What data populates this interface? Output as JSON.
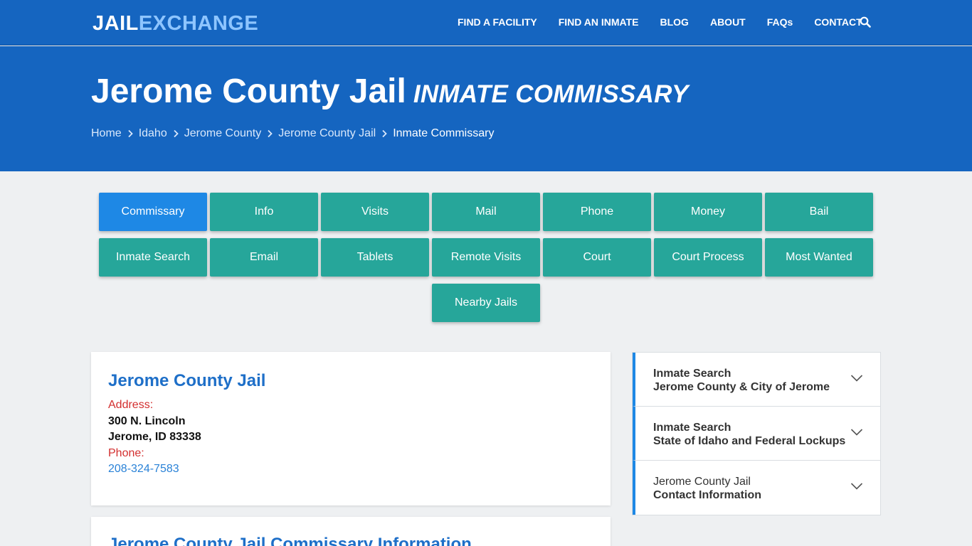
{
  "logo": {
    "part1": "JAIL",
    "part2": "EXCHANGE"
  },
  "nav": {
    "items": [
      "FIND A FACILITY",
      "FIND AN INMATE",
      "BLOG",
      "ABOUT",
      "FAQs",
      "CONTACT"
    ],
    "search_icon": "search-icon"
  },
  "hero": {
    "title": "Jerome County Jail",
    "subtitle": "INMATE COMMISSARY",
    "breadcrumbs": [
      "Home",
      "Idaho",
      "Jerome County",
      "Jerome County Jail",
      "Inmate Commissary"
    ]
  },
  "buttons": {
    "row1": [
      "Commissary",
      "Info",
      "Visits",
      "Mail",
      "Phone",
      "Money",
      "Bail"
    ],
    "row2": [
      "Inmate Search",
      "Email",
      "Tablets",
      "Remote Visits",
      "Court",
      "Court Process",
      "Most Wanted"
    ],
    "row3": [
      "Nearby Jails"
    ],
    "active": "Commissary"
  },
  "facility": {
    "title": "Jerome County Jail",
    "address_label": "Address:",
    "address_line1": "300 N. Lincoln",
    "address_line2": "Jerome, ID 83338",
    "phone_label": "Phone:",
    "phone": "208-324-7583"
  },
  "commissary_card": {
    "title": "Jerome County Jail Commissary Information"
  },
  "sidebar": {
    "items": [
      {
        "line1": "Inmate Search",
        "line2": "Jerome County & City of Jerome"
      },
      {
        "line1": "Inmate Search",
        "line2": "State of Idaho and Federal Lockups"
      },
      {
        "line1": "Jerome County Jail",
        "line2": "Contact Information"
      }
    ]
  },
  "colors": {
    "header_blue": "#1565c0",
    "teal_button": "#26a69a",
    "active_button": "#1e88e5",
    "link_blue": "#1e6fc8",
    "label_red": "#d32f2f"
  }
}
